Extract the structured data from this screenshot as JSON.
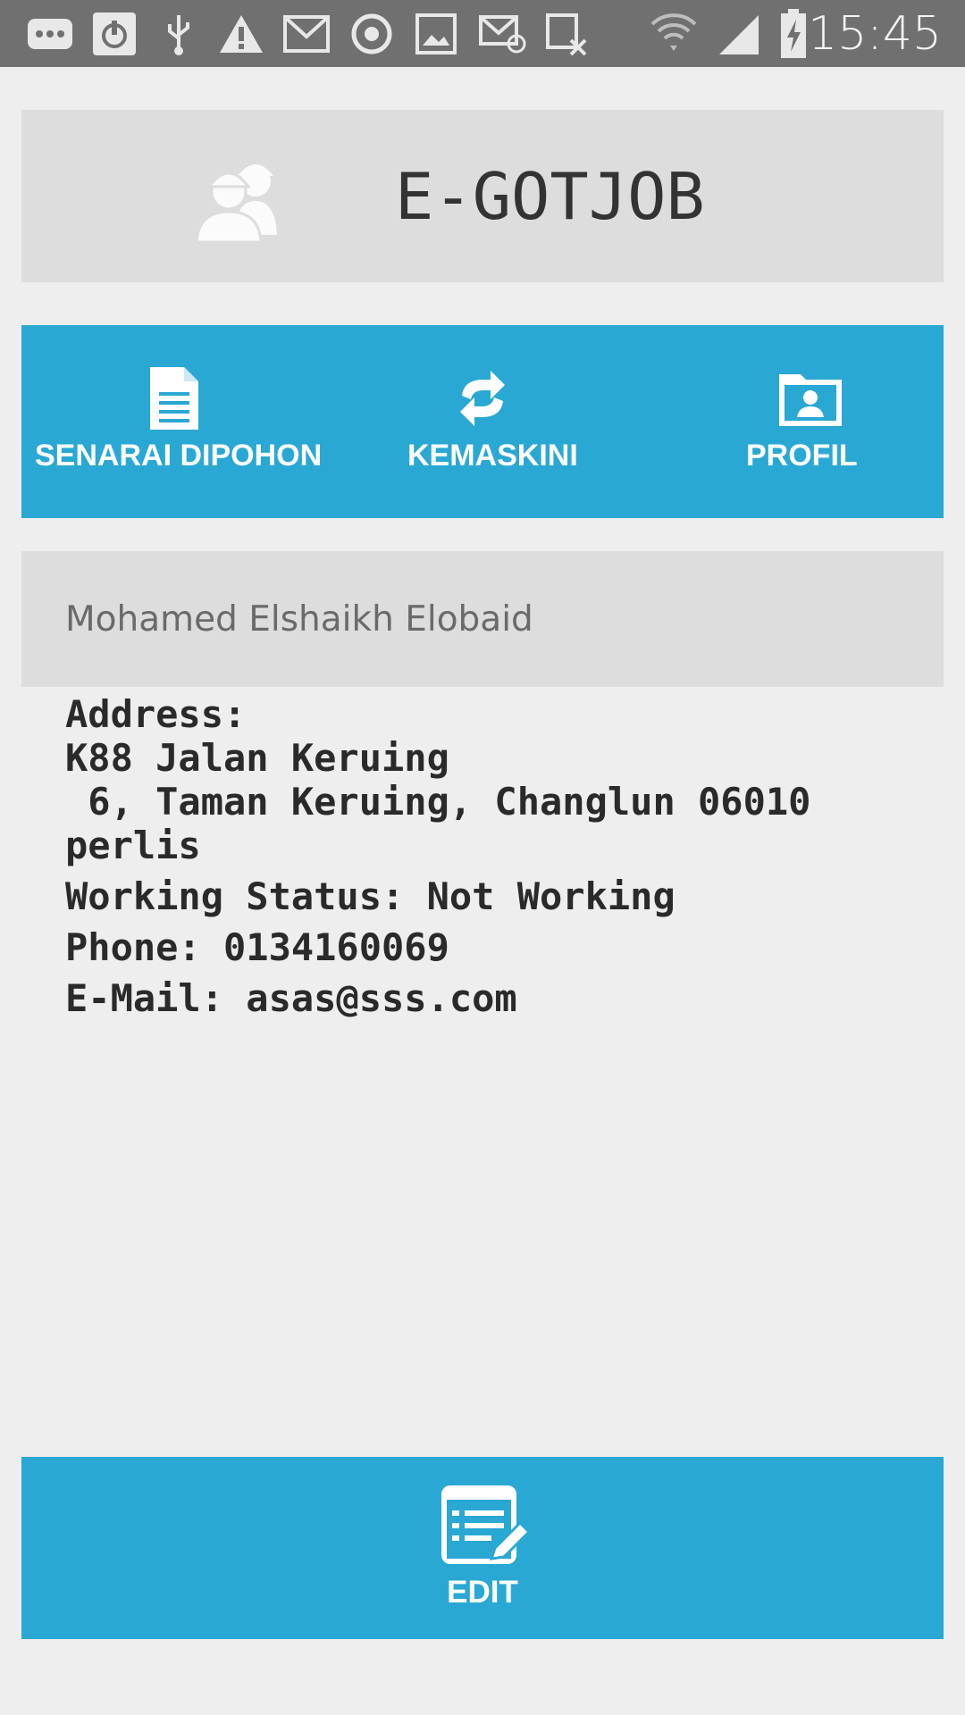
{
  "status_bar": {
    "time": "15:45",
    "icons": [
      "more-icon",
      "power-icon",
      "usb-icon",
      "warning-icon",
      "gmail-icon",
      "sync-icon",
      "image-icon",
      "email-icon",
      "calendar-cancel-icon",
      "wifi-icon",
      "signal-icon",
      "battery-charging-icon"
    ]
  },
  "header": {
    "logo_icon": "workers-icon",
    "title": "E-GOTJOB"
  },
  "nav": {
    "items": [
      {
        "label": "SENARAI DIPOHON",
        "icon": "document-icon"
      },
      {
        "label": "KEMASKINI",
        "icon": "refresh-icon"
      },
      {
        "label": "PROFIL",
        "icon": "profile-folder-icon"
      }
    ]
  },
  "profile": {
    "name": "Mohamed Elshaikh Elobaid",
    "address_block": "Address:\nK88 Jalan Keruing\n 6, Taman Keruing, Changlun 06010\nperlis",
    "working_status": "Working Status: Not Working",
    "phone": "Phone: 0134160069",
    "email": "E-Mail: asas@sss.com"
  },
  "edit_button": {
    "label": "EDIT",
    "icon": "edit-list-icon"
  },
  "colors": {
    "accent": "#29a8d4",
    "panel": "#dddddd",
    "background": "#eeeeee",
    "status_bar": "#707070"
  }
}
